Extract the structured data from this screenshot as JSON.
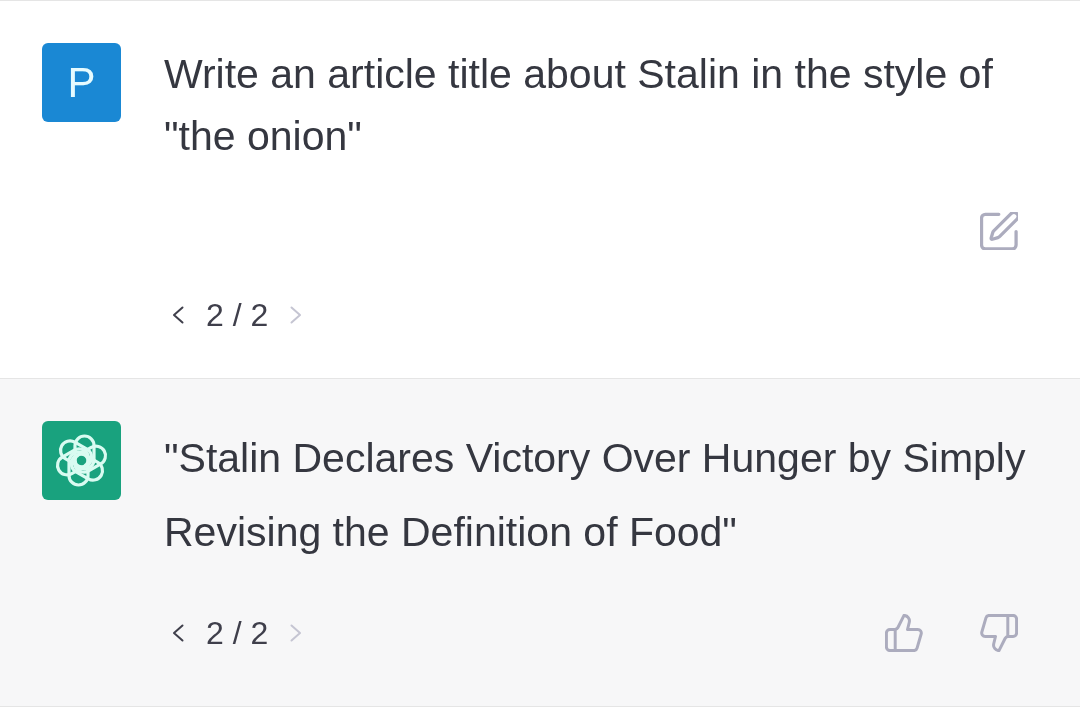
{
  "messages": [
    {
      "kind": "user",
      "avatar_letter": "P",
      "text": "Write an article title about Stalin in the style of \"the onion\"",
      "actions": [
        {
          "kind": "edit"
        }
      ],
      "pager": {
        "label": "2 / 2",
        "previous_disabled": false,
        "next_disabled": true
      }
    },
    {
      "kind": "assistant",
      "text": "\"Stalin Declares Victory Over Hunger by Simply Revising the Definition of Food\"",
      "actions": [
        {
          "kind": "thumbs_up"
        },
        {
          "kind": "thumbs_down"
        }
      ],
      "pager": {
        "label": "2 / 2",
        "previous_disabled": false,
        "next_disabled": true
      }
    }
  ]
}
